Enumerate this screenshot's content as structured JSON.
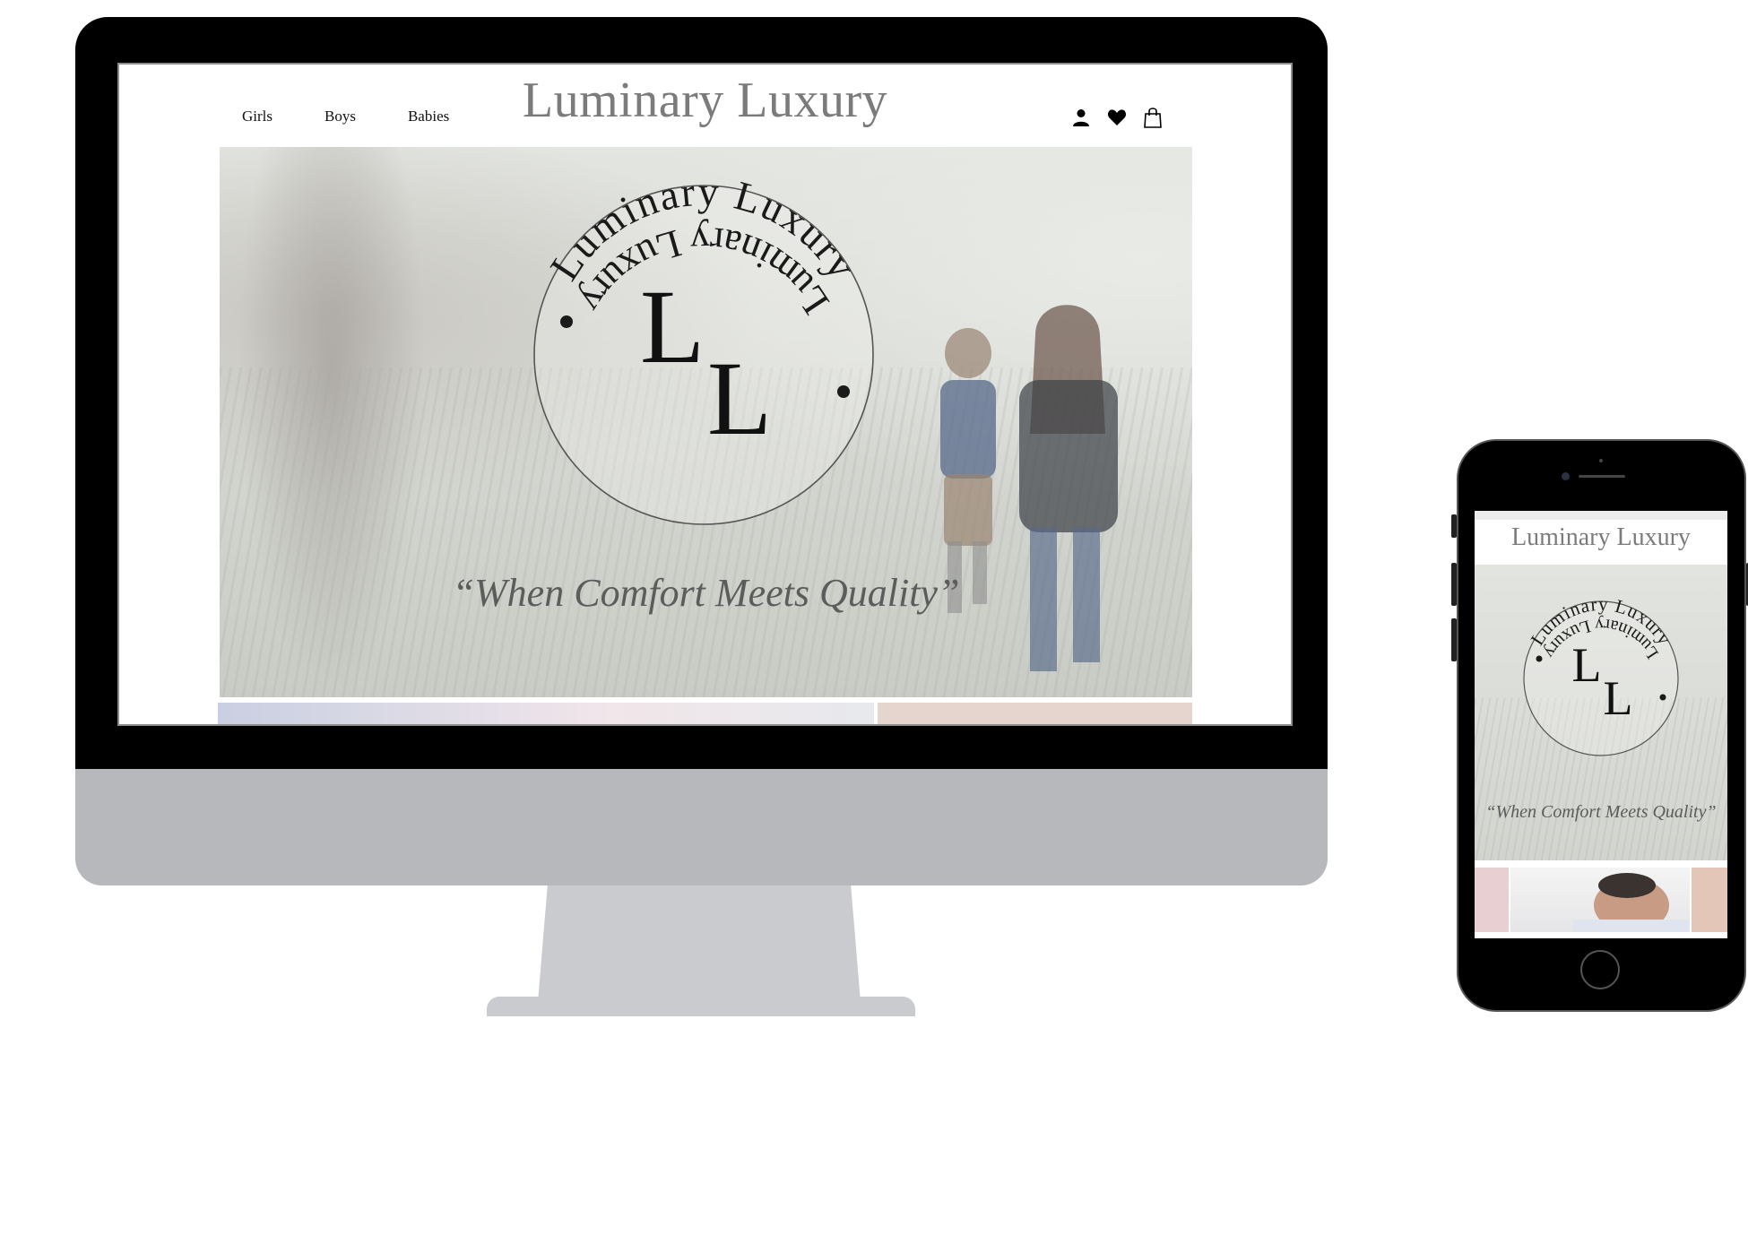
{
  "desktop": {
    "nav": [
      {
        "label": "Girls"
      },
      {
        "label": "Boys"
      },
      {
        "label": "Babies"
      }
    ],
    "site_title": "Luminary Luxury",
    "header_icons": [
      "account-icon",
      "heart-icon",
      "shopping-bag-icon"
    ],
    "hero": {
      "logo": {
        "ring_text_top": "Luminary Luxury",
        "ring_text_bottom": "Luminary Luxury",
        "monogram_1": "L",
        "monogram_2": "L"
      },
      "tagline": "“When Comfort Meets Quality”"
    }
  },
  "mobile": {
    "site_title": "Luminary Luxury",
    "hero": {
      "logo": {
        "ring_text_top": "Luminary Luxury",
        "ring_text_bottom": "Luminary Luxury",
        "monogram_1": "L",
        "monogram_2": "L"
      },
      "tagline": "“When Comfort Meets Quality”"
    }
  },
  "colors": {
    "frame": "#000000",
    "monitor_chin": "#b6b8bc",
    "title_gray": "#7b7b7b",
    "tagline_gray": "#5c5c5c"
  }
}
